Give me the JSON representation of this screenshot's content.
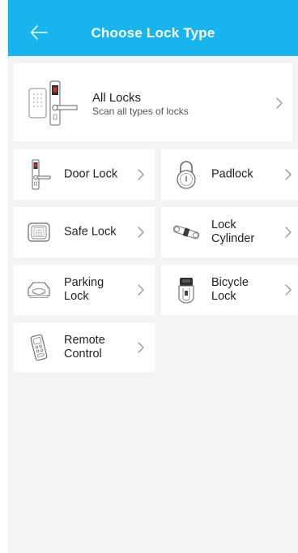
{
  "header": {
    "title": "Choose Lock Type",
    "bg_color": "#17b4ee"
  },
  "all_locks": {
    "title": "All Locks",
    "subtitle": "Scan all types of locks",
    "icon": "door-lock-with-keypad-icon"
  },
  "lock_types": [
    {
      "label": "Door Lock",
      "icon": "door-lock-icon"
    },
    {
      "label": "Padlock",
      "icon": "padlock-icon"
    },
    {
      "label": "Safe Lock",
      "icon": "safe-lock-icon"
    },
    {
      "label": "Lock\nCylinder",
      "icon": "lock-cylinder-icon"
    },
    {
      "label": "Parking\nLock",
      "icon": "parking-lock-icon"
    },
    {
      "label": "Bicycle\nLock",
      "icon": "bicycle-lock-icon"
    },
    {
      "label": "Remote\nControl",
      "icon": "remote-control-icon"
    }
  ]
}
